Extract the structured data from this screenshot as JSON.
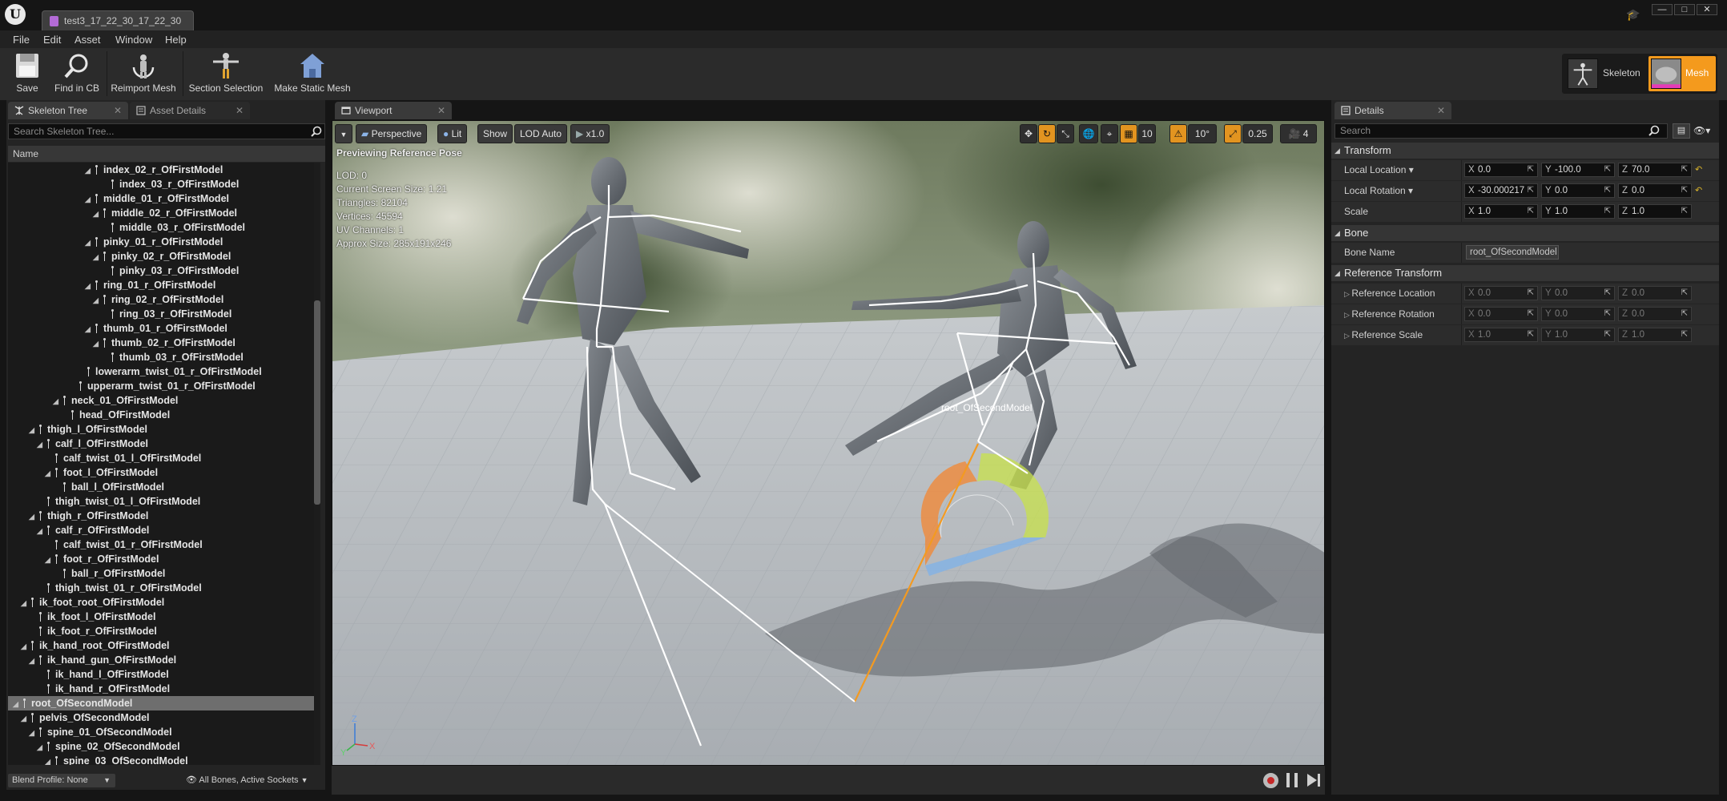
{
  "window": {
    "doc_tab_title": "test3_17_22_30_17_22_30",
    "controls": {
      "minimize": "—",
      "maximize": "□",
      "close": "✕"
    }
  },
  "menu": [
    "File",
    "Edit",
    "Asset",
    "Window",
    "Help"
  ],
  "toolbar": {
    "save": "Save",
    "find_in_cb": "Find in CB",
    "reimport_mesh": "Reimport Mesh",
    "section_selection": "Section Selection",
    "make_static_mesh": "Make Static Mesh"
  },
  "modes": {
    "skeleton": "Skeleton",
    "mesh": "Mesh"
  },
  "skeleton_tree": {
    "tab_label": "Skeleton Tree",
    "asset_details_tab": "Asset Details",
    "search_placeholder": "Search Skeleton Tree...",
    "column_header": "Name",
    "rows": [
      {
        "label": "index_02_r_OfFirstModel",
        "depth": 10,
        "expanded": true
      },
      {
        "label": "index_03_r_OfFirstModel",
        "depth": 12,
        "expanded": null
      },
      {
        "label": "middle_01_r_OfFirstModel",
        "depth": 10,
        "expanded": true
      },
      {
        "label": "middle_02_r_OfFirstModel",
        "depth": 11,
        "expanded": true
      },
      {
        "label": "middle_03_r_OfFirstModel",
        "depth": 12,
        "expanded": null
      },
      {
        "label": "pinky_01_r_OfFirstModel",
        "depth": 10,
        "expanded": true
      },
      {
        "label": "pinky_02_r_OfFirstModel",
        "depth": 11,
        "expanded": true
      },
      {
        "label": "pinky_03_r_OfFirstModel",
        "depth": 12,
        "expanded": null
      },
      {
        "label": "ring_01_r_OfFirstModel",
        "depth": 10,
        "expanded": true
      },
      {
        "label": "ring_02_r_OfFirstModel",
        "depth": 11,
        "expanded": true
      },
      {
        "label": "ring_03_r_OfFirstModel",
        "depth": 12,
        "expanded": null
      },
      {
        "label": "thumb_01_r_OfFirstModel",
        "depth": 10,
        "expanded": true
      },
      {
        "label": "thumb_02_r_OfFirstModel",
        "depth": 11,
        "expanded": true
      },
      {
        "label": "thumb_03_r_OfFirstModel",
        "depth": 12,
        "expanded": null
      },
      {
        "label": "lowerarm_twist_01_r_OfFirstModel",
        "depth": 9,
        "expanded": null
      },
      {
        "label": "upperarm_twist_01_r_OfFirstModel",
        "depth": 8,
        "expanded": null
      },
      {
        "label": "neck_01_OfFirstModel",
        "depth": 6,
        "expanded": true
      },
      {
        "label": "head_OfFirstModel",
        "depth": 7,
        "expanded": null
      },
      {
        "label": "thigh_l_OfFirstModel",
        "depth": 3,
        "expanded": true
      },
      {
        "label": "calf_l_OfFirstModel",
        "depth": 4,
        "expanded": true
      },
      {
        "label": "calf_twist_01_l_OfFirstModel",
        "depth": 5,
        "expanded": null
      },
      {
        "label": "foot_l_OfFirstModel",
        "depth": 5,
        "expanded": true
      },
      {
        "label": "ball_l_OfFirstModel",
        "depth": 6,
        "expanded": null
      },
      {
        "label": "thigh_twist_01_l_OfFirstModel",
        "depth": 4,
        "expanded": null
      },
      {
        "label": "thigh_r_OfFirstModel",
        "depth": 3,
        "expanded": true
      },
      {
        "label": "calf_r_OfFirstModel",
        "depth": 4,
        "expanded": true
      },
      {
        "label": "calf_twist_01_r_OfFirstModel",
        "depth": 5,
        "expanded": null
      },
      {
        "label": "foot_r_OfFirstModel",
        "depth": 5,
        "expanded": true
      },
      {
        "label": "ball_r_OfFirstModel",
        "depth": 6,
        "expanded": null
      },
      {
        "label": "thigh_twist_01_r_OfFirstModel",
        "depth": 4,
        "expanded": null
      },
      {
        "label": "ik_foot_root_OfFirstModel",
        "depth": 2,
        "expanded": true
      },
      {
        "label": "ik_foot_l_OfFirstModel",
        "depth": 3,
        "expanded": null
      },
      {
        "label": "ik_foot_r_OfFirstModel",
        "depth": 3,
        "expanded": null
      },
      {
        "label": "ik_hand_root_OfFirstModel",
        "depth": 2,
        "expanded": true
      },
      {
        "label": "ik_hand_gun_OfFirstModel",
        "depth": 3,
        "expanded": true
      },
      {
        "label": "ik_hand_l_OfFirstModel",
        "depth": 4,
        "expanded": null
      },
      {
        "label": "ik_hand_r_OfFirstModel",
        "depth": 4,
        "expanded": null
      },
      {
        "label": "root_OfSecondModel",
        "depth": 1,
        "expanded": true,
        "selected": true
      },
      {
        "label": "pelvis_OfSecondModel",
        "depth": 2,
        "expanded": true
      },
      {
        "label": "spine_01_OfSecondModel",
        "depth": 3,
        "expanded": true
      },
      {
        "label": "spine_02_OfSecondModel",
        "depth": 4,
        "expanded": true
      },
      {
        "label": "spine_03_OfSecondModel",
        "depth": 5,
        "expanded": true
      }
    ],
    "blend_profile": "Blend Profile: None",
    "bones_filter": "All Bones, Active Sockets"
  },
  "viewport": {
    "tab_label": "Viewport",
    "perspective": "Perspective",
    "lit": "Lit",
    "show": "Show",
    "lod": "LOD Auto",
    "play_rate": "x1.0",
    "grid_snap": "10",
    "rotation_snap": "10°",
    "scale_snap": "0.25",
    "camera_speed": "4",
    "info": {
      "previewing": "Previewing Reference Pose",
      "lod": "LOD: 0",
      "screen_size": "Current Screen Size: 1.21",
      "triangles": "Triangles: 82104",
      "vertices": "Vertices: 45594",
      "uv_channels": "UV Channels: 1",
      "approx_size": "Approx Size: 285x191x246"
    },
    "bone_label": "root_OfSecondModel",
    "axis_z": "Z",
    "axis_y": "Y",
    "axis_x": "X"
  },
  "details": {
    "tab_label": "Details",
    "search_placeholder": "Search",
    "transform_section": "Transform",
    "local_location_label": "Local Location",
    "local_location": {
      "x": "0.0",
      "y": "-100.0",
      "z": "70.0"
    },
    "local_rotation_label": "Local Rotation",
    "local_rotation": {
      "x": "-30.000217",
      "y": "0.0",
      "z": "0.0"
    },
    "scale_label": "Scale",
    "scale": {
      "x": "1.0",
      "y": "1.0",
      "z": "1.0"
    },
    "bone_section": "Bone",
    "bone_name_label": "Bone Name",
    "bone_name": "root_OfSecondModel",
    "reference_section": "Reference Transform",
    "reference_location_label": "Reference Location",
    "reference_location": {
      "x": "0.0",
      "y": "0.0",
      "z": "0.0"
    },
    "reference_rotation_label": "Reference Rotation",
    "reference_rotation": {
      "x": "0.0",
      "y": "0.0",
      "z": "0.0"
    },
    "reference_scale_label": "Reference Scale",
    "reference_scale": {
      "x": "1.0",
      "y": "1.0",
      "z": "1.0"
    }
  },
  "colors": {
    "accent_orange": "#f49a1d",
    "selection_gray": "#6e6e6e",
    "panel_bg": "#242424",
    "bone_white": "#ffffff",
    "highlight_bone": "#f39a21"
  },
  "icons": {
    "logo": "unreal-logo",
    "save": "save-disk-icon",
    "find": "magnifier-icon",
    "reimport": "reimport-mesh-icon",
    "section": "section-selection-icon",
    "static_mesh": "make-static-mesh-icon"
  }
}
